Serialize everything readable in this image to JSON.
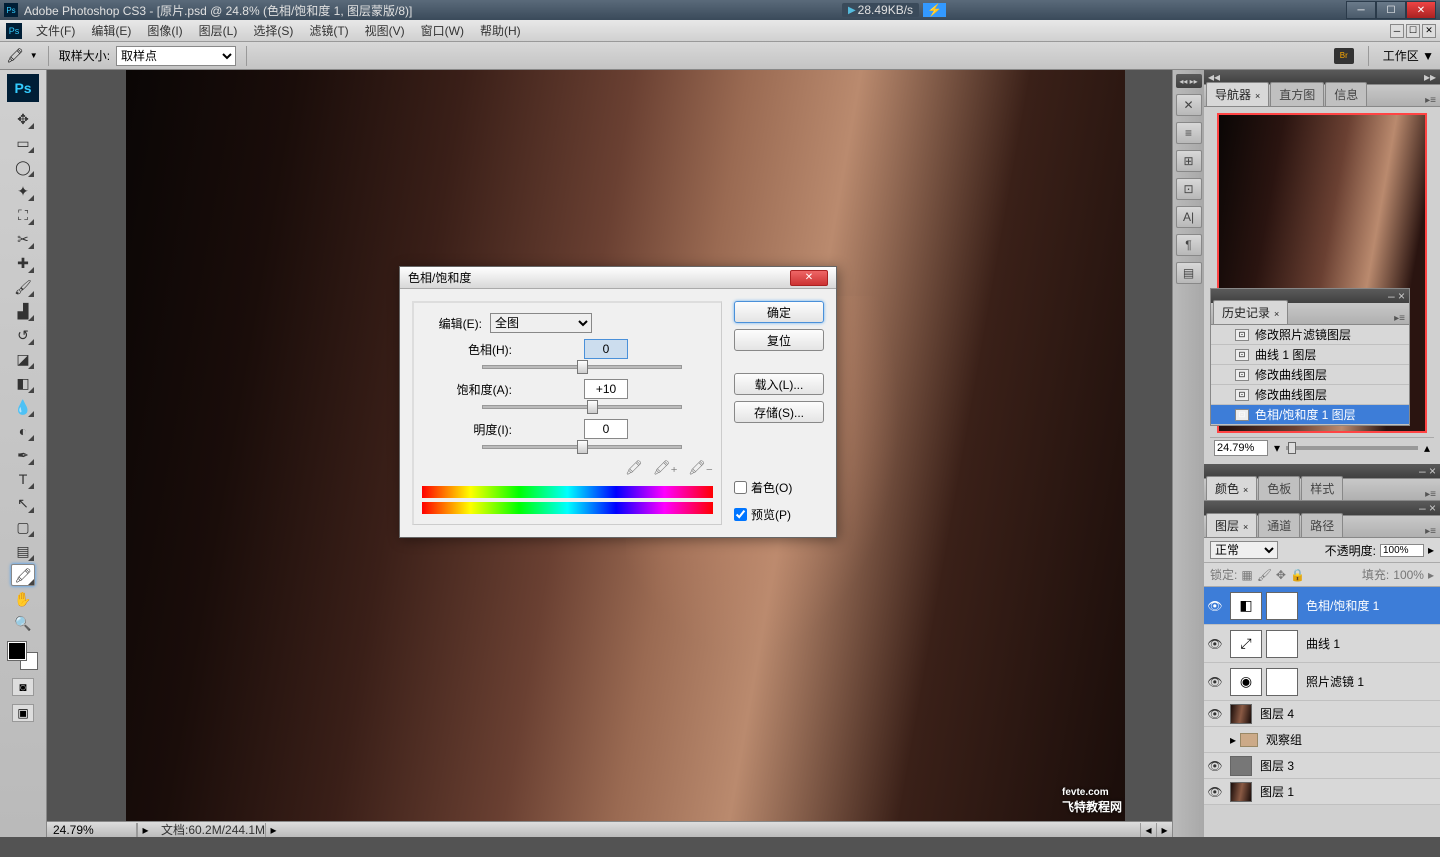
{
  "titlebar": {
    "title": "Adobe Photoshop CS3 - [原片.psd @ 24.8% (色相/饱和度 1, 图层蒙版/8)]",
    "netspeed": "28.49KB/s"
  },
  "menu": [
    "文件(F)",
    "编辑(E)",
    "图像(I)",
    "图层(L)",
    "选择(S)",
    "滤镜(T)",
    "视图(V)",
    "窗口(W)",
    "帮助(H)"
  ],
  "options": {
    "sample_label": "取样大小:",
    "sample_value": "取样点",
    "workspace_label": "工作区 ▼"
  },
  "statusbar": {
    "zoom": "24.79%",
    "docinfo": "文档:60.2M/244.1M"
  },
  "navigator": {
    "tabs": [
      "导航器",
      "直方图",
      "信息"
    ],
    "zoom": "24.79%"
  },
  "history": {
    "tab": "历史记录",
    "items": [
      "修改照片滤镜图层",
      "曲线 1 图层",
      "修改曲线图层",
      "修改曲线图层",
      "色相/饱和度 1 图层"
    ],
    "selected_index": 4
  },
  "color_panel": {
    "tabs": [
      "颜色",
      "色板",
      "样式"
    ]
  },
  "layers_panel": {
    "tabs": [
      "图层",
      "通道",
      "路径"
    ],
    "blend_mode": "正常",
    "opacity_label": "不透明度:",
    "opacity_value": "100%",
    "lock_label": "锁定:",
    "fill_label": "填充:",
    "fill_value": "100%",
    "layers": [
      {
        "name": "色相/饱和度 1",
        "type": "adj",
        "selected": true
      },
      {
        "name": "曲线 1",
        "type": "adj"
      },
      {
        "name": "照片滤镜 1",
        "type": "adj"
      },
      {
        "name": "图层 4",
        "type": "img"
      },
      {
        "name": "观察组",
        "type": "group"
      },
      {
        "name": "图层 3",
        "type": "img"
      },
      {
        "name": "图层 1",
        "type": "img"
      }
    ]
  },
  "dialog": {
    "title": "色相/饱和度",
    "edit_label": "编辑(E):",
    "edit_value": "全图",
    "hue_label": "色相(H):",
    "hue_value": "0",
    "sat_label": "饱和度(A):",
    "sat_value": "+10",
    "light_label": "明度(I):",
    "light_value": "0",
    "colorize_label": "着色(O)",
    "preview_label": "预览(P)",
    "btn_ok": "确定",
    "btn_cancel": "复位",
    "btn_load": "载入(L)...",
    "btn_save": "存储(S)..."
  },
  "watermark": {
    "domain": "fevte.com",
    "text": "飞特教程网"
  }
}
